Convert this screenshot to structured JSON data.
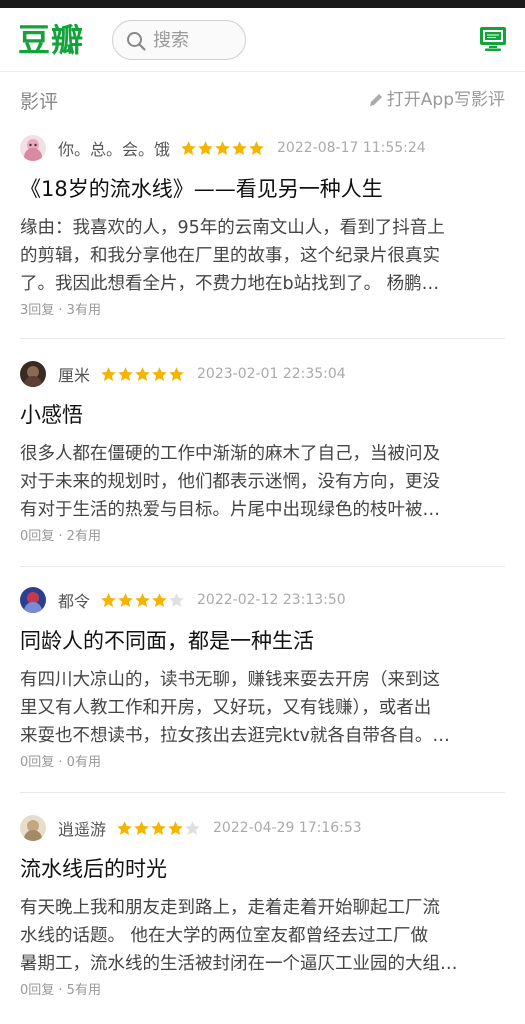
{
  "header": {
    "logo": "豆瓣",
    "search_placeholder": "搜索",
    "brand_color": "#12a33a"
  },
  "section": {
    "title": "影评",
    "open_app": "打开App写影评"
  },
  "reviews": [
    {
      "author": "你。总。会。饿",
      "rating": 5,
      "date": "2022-08-17 11:55:24",
      "title": "《18岁的流水线》——看见另一种人生",
      "lines": [
        "缘由：我喜欢的人，95年的云南文山人，看到了抖音上",
        "的剪辑，和我分享他在厂里的故事，这个纪录片很真实",
        "了。我因此想看全片，不费力地在b站找到了。 杨鹏…"
      ],
      "meta": "3回复 · 3有用"
    },
    {
      "author": "厘米",
      "rating": 5,
      "date": "2023-02-01 22:35:04",
      "title": "小感悟",
      "lines": [
        "很多人都在僵硬的工作中渐渐的麻木了自己，当被问及",
        "对于未来的规划时，他们都表示迷惘，没有方向，更没",
        "有对于生活的热爱与目标。片尾中出现绿色的枝叶被…"
      ],
      "meta": "0回复 · 2有用"
    },
    {
      "author": "都令",
      "rating": 4,
      "date": "2022-02-12 23:13:50",
      "title": "同龄人的不同面，都是一种生活",
      "lines": [
        "有四川大凉山的，读书无聊，赚钱来耍去开房（来到这",
        "里又有人教工作和开房，又好玩，又有钱赚），或者出",
        "来耍也不想读书，拉女孩出去逛完ktv就各自带各自。…"
      ],
      "meta": "0回复 · 0有用"
    },
    {
      "author": "逍遥游",
      "rating": 4,
      "date": "2022-04-29 17:16:53",
      "title": "流水线后的时光",
      "lines": [
        "有天晚上我和朋友走到路上，走着走着开始聊起工厂流",
        "水线的话题。 他在大学的两位室友都曾经去过工厂做",
        "暑期工，流水线的生活被封闭在一个逼仄工业园的大组…"
      ],
      "meta": "0回复 · 5有用"
    }
  ],
  "colors": {
    "star_on": "#f5b400",
    "star_off": "#e0e0e0"
  }
}
